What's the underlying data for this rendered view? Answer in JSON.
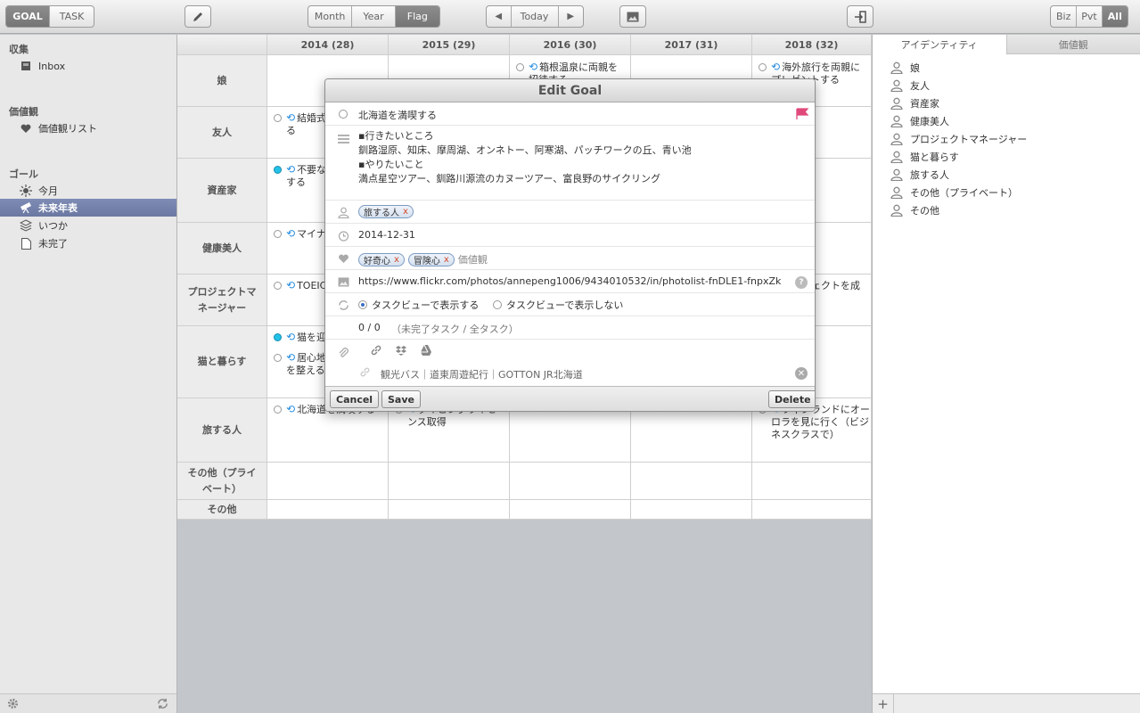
{
  "toolbar": {
    "mode_goal": "GOAL",
    "mode_task": "TASK",
    "view_month": "Month",
    "view_year": "Year",
    "view_flag": "Flag",
    "today": "Today",
    "filter_biz": "Biz",
    "filter_pvt": "Pvt",
    "filter_all": "All"
  },
  "sidebar": {
    "sec_collect": "収集",
    "inbox": "Inbox",
    "sec_values": "価値観",
    "values_list": "価値観リスト",
    "sec_goal": "ゴール",
    "this_month": "今月",
    "future_chrono": "未来年表",
    "someday": "いつか",
    "incomplete": "未完了"
  },
  "grid": {
    "years": [
      "2014 (28)",
      "2015 (29)",
      "2016 (30)",
      "2017 (31)",
      "2018 (32)"
    ],
    "rows": [
      "娘",
      "友人",
      "資産家",
      "健康美人",
      "プロジェクトマネージャー",
      "猫と暮らす",
      "旅する人",
      "その他（プライベート）",
      "その他"
    ],
    "items": {
      "r0_2016": "箱根温泉に両親を招待する",
      "r0_2018": "海外旅行を両親にプレゼントする",
      "r1_2014": "結婚式を成功させる",
      "r2_2014": "不要な支出を節約する",
      "r3_2014": "マイナス5kg達成",
      "r4_2014": "TOEIC800点達",
      "r4_2018": "プロジェクトを成功させる",
      "r5_2014a": "猫を迎える",
      "r5_2014b": "居心地の良い環境を整える",
      "r6_2014": "北海道を満喫する",
      "r6_2015": "ダイビングライセンス取得",
      "r6_2018": "フィンランドにオーロラを見に行く（ビジネスクラスで）"
    }
  },
  "right": {
    "tab_identity": "アイデンティティ",
    "tab_values": "価値観",
    "identities": [
      "娘",
      "友人",
      "資産家",
      "健康美人",
      "プロジェクトマネージャー",
      "猫と暮らす",
      "旅する人",
      "その他（プライベート）",
      "その他"
    ]
  },
  "dialog": {
    "title": "Edit Goal",
    "goal_title": "北海道を満喫する",
    "notes": [
      "▪行きたいところ",
      "釧路湿原、知床、摩周湖、オンネトー、阿寒湖、パッチワークの丘、青い池",
      "▪やりたいこと",
      "満点星空ツアー、釧路川源流のカヌーツアー、富良野のサイクリング"
    ],
    "identity_tag": "旅する人",
    "tag_remove": "x",
    "date": "2014-12-31",
    "value_tags": [
      "好奇心",
      "冒険心"
    ],
    "values_placeholder": "価値観",
    "image_url": "https://www.flickr.com/photos/annepeng1006/9434010532/in/photolist-fnDLE1-fnpxZk",
    "show_in_taskview": "タスクビューで表示する",
    "hide_in_taskview": "タスクビューで表示しない",
    "task_count": "0 / 0",
    "task_count_label": "（未完了タスク / 全タスク）",
    "link_text": "観光バス｜道東周遊紀行｜GOTTON JR北海道",
    "cancel": "Cancel",
    "save": "Save",
    "delete": "Delete"
  },
  "colors": {
    "selected": "#7180a9",
    "flag": "#e0487a",
    "checkbox_done": "#22c1e8"
  }
}
